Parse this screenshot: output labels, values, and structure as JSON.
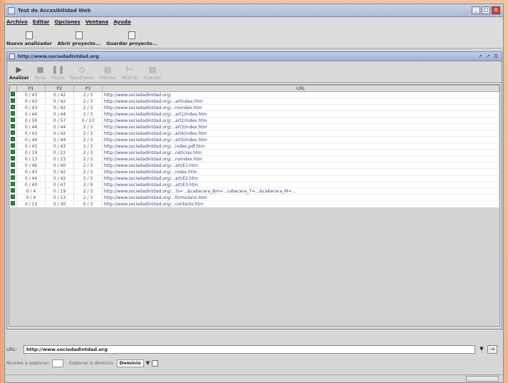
{
  "window": {
    "title": "Test de Accesibilidad Web",
    "controls": [
      "_",
      "□",
      "X"
    ]
  },
  "menubar": [
    "Archivo",
    "Editar",
    "Opciones",
    "Ventana",
    "Ayuda"
  ],
  "toolbar": [
    {
      "label": "Nuevo analizador",
      "icon": "document-icon"
    },
    {
      "label": "Abrir proyecto...",
      "icon": "folder-open-icon"
    },
    {
      "label": "Guardar proyecto...",
      "icon": "save-icon"
    }
  ],
  "analyzer": {
    "title": "http://www.sociedadintdad.org",
    "title_controls": [
      "↗",
      "↗",
      "☰"
    ],
    "toolbar": [
      {
        "label": "Analizar",
        "icon": "▶",
        "active": true
      },
      {
        "label": "Parar",
        "icon": "■",
        "active": false
      },
      {
        "label": "Pausa",
        "icon": "❚❚",
        "active": false
      },
      {
        "label": "Resultados",
        "icon": "◇",
        "active": false
      },
      {
        "label": "Informe",
        "icon": "▤",
        "active": false
      },
      {
        "label": "Mostrar",
        "icon": "⊢",
        "active": false
      },
      {
        "label": "Guardar",
        "icon": "▤",
        "active": false
      }
    ],
    "columns": [
      "",
      "P1",
      "P2",
      "P3",
      "URL"
    ],
    "rows": [
      {
        "p1": "0 / 43",
        "p2": "0 / 42",
        "p3": "2 / 3",
        "url": "http://www.sociedadintdad.org/"
      },
      {
        "p1": "0 / 43",
        "p2": "0 / 42",
        "p3": "2 / 3",
        "url": "http://www.sociedadintdad.org/...artindex.htm"
      },
      {
        "p1": "0 / 43",
        "p2": "0 / 42",
        "p3": "2 / 3",
        "url": "http://www.sociedadintdad.org/...noindex.htm"
      },
      {
        "p1": "0 / 44",
        "p2": "0 / 44",
        "p3": "2 / 3",
        "url": "http://www.sociedadintdad.org/...art1/index.htm"
      },
      {
        "p1": "0 / 50",
        "p2": "0 / 57",
        "p3": "0 / 13",
        "url": "http://www.sociedadintdad.org/...art2/index.htm"
      },
      {
        "p1": "0 / 44",
        "p2": "0 / 44",
        "p3": "2 / 3",
        "url": "http://www.sociedadintdad.org/...art3/index.htm"
      },
      {
        "p1": "0 / 43",
        "p2": "0 / 42",
        "p3": "2 / 3",
        "url": "http://www.sociedadintdad.org/...art4/index.htm"
      },
      {
        "p1": "0 / 44",
        "p2": "0 / 44",
        "p3": "2 / 3",
        "url": "http://www.sociedadintdad.org/...art5/index.htm"
      },
      {
        "p1": "0 / 43",
        "p2": "0 / 43",
        "p3": "2 / 3",
        "url": "http://www.sociedadintdad.org/...index.pdf.htm"
      },
      {
        "p1": "0 / 19",
        "p2": "0 / 22",
        "p3": "2 / 3",
        "url": "http://www.sociedadintdad.org/...noticias.htm"
      },
      {
        "p1": "0 / 13",
        "p2": "0 / 23",
        "p3": "2 / 3",
        "url": "http://www.sociedadintdad.org/...noindex.htm"
      },
      {
        "p1": "0 / 46",
        "p2": "0 / 40",
        "p3": "2 / 3",
        "url": "http://www.sociedadintdad.org/...art/E1.htm"
      },
      {
        "p1": "0 / 43",
        "p2": "0 / 42",
        "p3": "2 / 3",
        "url": "http://www.sociedadintdad.org/...index.htm"
      },
      {
        "p1": "0 / 44",
        "p2": "0 / 42",
        "p3": "2 / 3",
        "url": "http://www.sociedadintdad.org/...art/E2.htm"
      },
      {
        "p1": "0 / 40",
        "p2": "0 / 47",
        "p3": "2 / 9",
        "url": "http://www.sociedadintdad.org/...art/E3.htm"
      },
      {
        "p1": "0 / 4",
        "p2": "0 / 19",
        "p3": "2 / 3",
        "url": "http://www.sociedadintdad.org/...?s=...&cabecera_Bm=...cabecera_T=...&cabecera_M=..."
      },
      {
        "p1": "0 / 4",
        "p2": "0 / 13",
        "p3": "2 / 3",
        "url": "http://www.sociedadintdad.org/...formulario.htm"
      },
      {
        "p1": "0 / 13",
        "p2": "0 / 30",
        "p3": "0 / 3",
        "url": "http://www.sociedadintdad.org/...contacto.htm"
      }
    ]
  },
  "url_bar": {
    "label": "URL:",
    "value": "http://www.sociedadintdad.org"
  },
  "options": {
    "depth_label": "Niveles a explorar:",
    "depth_value": "",
    "scope_label": "Explorar a dominio:",
    "scope_value": "Dominio"
  },
  "status": {
    "cell": ""
  }
}
